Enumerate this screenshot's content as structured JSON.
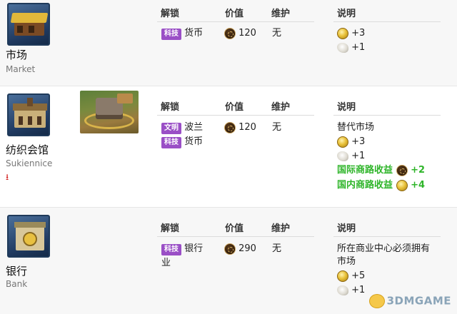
{
  "headers": {
    "unlock": "解锁",
    "cost": "价值",
    "maintenance": "维护",
    "desc": "说明"
  },
  "tags": {
    "tech": "科技",
    "civic": "文明"
  },
  "rows": [
    {
      "name_cn": "市场",
      "name_en": "Market",
      "unlock_tech": "货币",
      "cost": "120",
      "maintenance": "无",
      "desc": {
        "gold": "+3",
        "amenity": "+1"
      }
    },
    {
      "name_cn": "纺织会馆",
      "name_en": "Sukiennice",
      "unlock_civ": "波兰",
      "unlock_tech": "货币",
      "cost": "120",
      "maintenance": "无",
      "desc": {
        "replaces": "替代市场",
        "gold": "+3",
        "amenity": "+1",
        "intl_route_label": "国际商路收益",
        "intl_route_value": "+2",
        "dom_route_label": "国内商路收益",
        "dom_route_value": "+4"
      }
    },
    {
      "name_cn": "银行",
      "name_en": "Bank",
      "unlock_tech": "银行业",
      "unlock_tech_a": "银行",
      "unlock_tech_b": "业",
      "cost": "290",
      "maintenance": "无",
      "desc": {
        "req_line1": "所在商业中心必须拥有",
        "req_line2": "市场",
        "gold": "+5",
        "amenity": "+1"
      }
    }
  ],
  "watermark": "3DMGAME",
  "colors": {
    "tag_bg": "#9a4fc6",
    "green": "#2fb52a",
    "download": "#d01818"
  }
}
